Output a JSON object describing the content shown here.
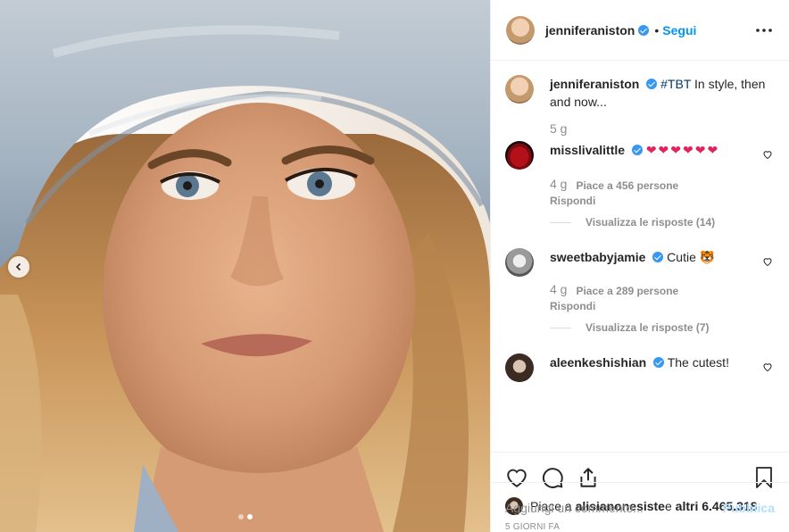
{
  "post": {
    "author": "jenniferaniston",
    "follow_label": "Segui",
    "separator": "•",
    "caption_hashtag": "#TBT",
    "caption_text": " In style, then and now...",
    "caption_time": "5 g",
    "carousel": {
      "total": 2,
      "active": 2
    }
  },
  "comments": [
    {
      "user": "misslivalittle",
      "text": "❤❤❤❤❤❤",
      "time": "4 g",
      "likes": "Piace a 456 persone",
      "reply_label": "Rispondi",
      "view_replies": "Visualizza le risposte (14)"
    },
    {
      "user": "sweetbabyjamie",
      "text": "Cutie 🐯",
      "time": "4 g",
      "likes": "Piace a 289 persone",
      "reply_label": "Rispondi",
      "view_replies": "Visualizza le risposte (7)"
    },
    {
      "user": "aleenkeshishian",
      "text": "The cutest!"
    }
  ],
  "liked_by": {
    "prefix": "Piace a ",
    "user": "alisianonesiste",
    "middle": " e ",
    "others": "altri 6.465.318"
  },
  "date": "5 GIORNI FA",
  "add_comment": {
    "placeholder": "Aggiungi un commento...",
    "publish_label": "Pubblica"
  },
  "colors": {
    "link_blue": "#0095f6",
    "verified_blue": "#3897f0",
    "muted": "#8e8e8e",
    "publish_disabled": "#b2dffc"
  },
  "icons": [
    "chevron-left-icon",
    "more-icon",
    "heart-icon",
    "comment-icon",
    "share-icon",
    "bookmark-icon",
    "verified-icon"
  ]
}
